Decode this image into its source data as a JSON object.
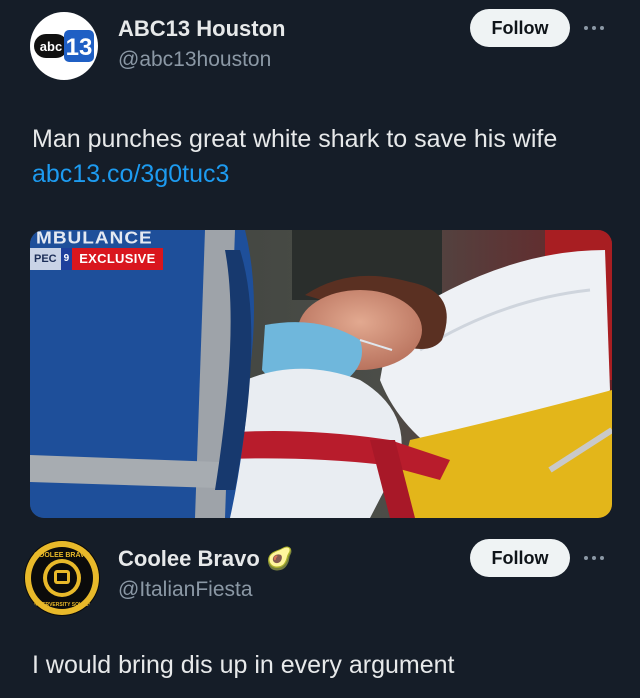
{
  "tweet1": {
    "author_name": "ABC13 Houston",
    "handle": "@abc13houston",
    "avatar_logo_text": "abc 13",
    "follow_label": "Follow",
    "text": "Man punches great white shark to save his wife",
    "link_text": "abc13.co/3g0tuc3",
    "media": {
      "ambulance_text": "MBULANCE",
      "badge_prefix": "PEC",
      "channel_logo": "9",
      "badge_label": "EXCLUSIVE"
    }
  },
  "tweet2": {
    "author_name": "Coolee Bravo",
    "name_emoji": "🥑",
    "handle": "@ItalianFiesta",
    "avatar_logo_text": "COOLEE BRAVO · INTERVERSITY SOUND",
    "follow_label": "Follow",
    "text": "I would bring dis up in every argument"
  },
  "colors": {
    "background": "#151d28",
    "link": "#1d9bf0",
    "follow_bg": "#eff3f4",
    "secondary_text": "#8b98a5",
    "exclusive_red": "#d9161e"
  }
}
